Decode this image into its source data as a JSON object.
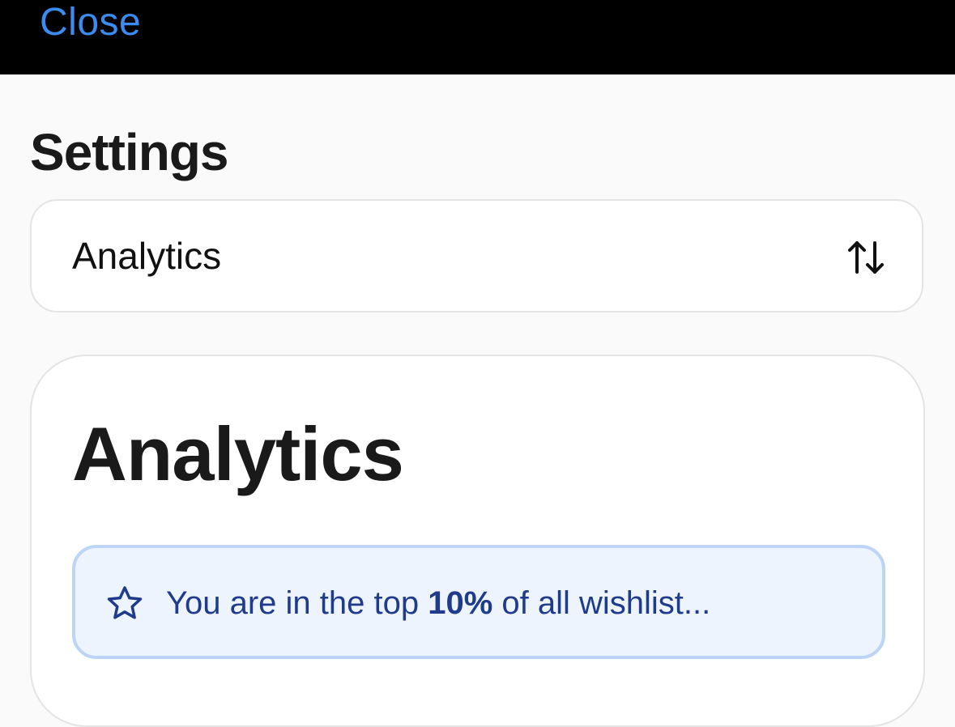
{
  "topbar": {
    "close_label": "Close",
    "accent_color": "#3b8cf0"
  },
  "header": {
    "title": "Settings"
  },
  "section_selector": {
    "selected": "Analytics",
    "icon": "sort-arrows-icon"
  },
  "analytics_card": {
    "title": "Analytics",
    "banner": {
      "icon": "star-icon",
      "text_before": "You are in the top ",
      "highlight": "10%",
      "text_after": " of all wishlist..."
    }
  }
}
